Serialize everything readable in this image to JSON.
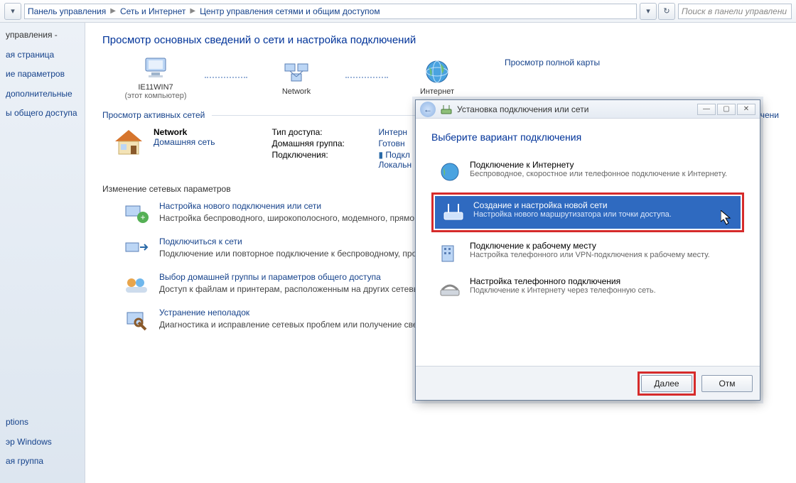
{
  "breadcrumb": {
    "items": [
      "Панель управления",
      "Сеть и Интернет",
      "Центр управления сетями и общим доступом"
    ]
  },
  "search": {
    "placeholder": "Поиск в панели управлени"
  },
  "sidebar": {
    "top": [
      "управления -",
      "ая страница",
      "ие параметров",
      "дополнительные",
      "ы общего доступа"
    ],
    "bottom": [
      "ptions",
      "эр Windows",
      "ая группа"
    ]
  },
  "page": {
    "title": "Просмотр основных сведений о сети и настройка подключений",
    "map_link": "Просмотр полной карты",
    "nodes": {
      "pc": "IE11WIN7",
      "pc_sub": "(этот компьютер)",
      "net": "Network",
      "inet": "Интернет"
    },
    "active_header": "Просмотр активных сетей",
    "active_link": "Подключени",
    "network": {
      "name": "Network",
      "type": "Домашняя сеть"
    },
    "kv": {
      "k1": "Тип доступа:",
      "v1": "Интерн",
      "k2": "Домашняя группа:",
      "v2": "Готовн",
      "k3": "Подключения:",
      "v3": "Подкл",
      "v3b": "Локальн"
    },
    "changes": "Изменение сетевых параметров",
    "tasks": [
      {
        "t": "Настройка нового подключения или сети",
        "d": "Настройка беспроводного, широкополосного, модемного, прямого или VPN или же настройка маршрутизатора или точки доступа."
      },
      {
        "t": "Подключиться к сети",
        "d": "Подключение или повторное подключение к беспроводному, проводному, сетевому соединению или подключение к VPN."
      },
      {
        "t": "Выбор домашней группы и параметров общего доступа",
        "d": "Доступ к файлам и принтерам, расположенным на других сетевых компьюте изменение параметров общего доступа."
      },
      {
        "t": "Устранение неполадок",
        "d": "Диагностика и исправление сетевых проблем или получение сведений об ис"
      }
    ]
  },
  "wizard": {
    "header": "Установка подключения или сети",
    "title": "Выберите вариант подключения",
    "options": [
      {
        "t": "Подключение к Интернету",
        "s": "Беспроводное, скоростное или телефонное подключение к Интернету."
      },
      {
        "t": "Создание и настройка новой сети",
        "s": "Настройка нового маршрутизатора или точки доступа."
      },
      {
        "t": "Подключение к рабочему месту",
        "s": "Настройка телефонного или VPN-подключения к рабочему месту."
      },
      {
        "t": "Настройка телефонного подключения",
        "s": "Подключение к Интернету через телефонную сеть."
      }
    ],
    "next": "Далее",
    "cancel": "Отм"
  }
}
